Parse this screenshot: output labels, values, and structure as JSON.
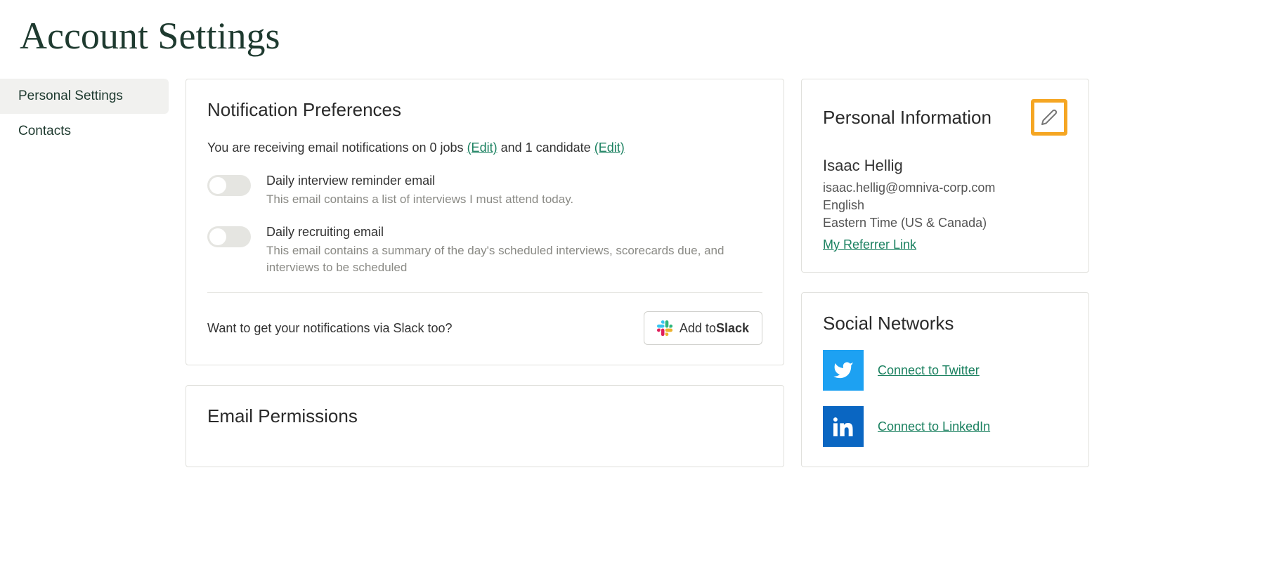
{
  "page_title": "Account Settings",
  "sidebar": {
    "items": [
      {
        "label": "Personal Settings",
        "active": true
      },
      {
        "label": "Contacts",
        "active": false
      }
    ]
  },
  "notifications": {
    "heading": "Notification Preferences",
    "line_part1": "You are receiving email notifications on 0 jobs ",
    "edit1": "(Edit)",
    "line_part2": " and 1 candidate ",
    "edit2": "(Edit)",
    "prefs": [
      {
        "title": "Daily interview reminder email",
        "desc": "This email contains a list of interviews I must attend today."
      },
      {
        "title": "Daily recruiting email",
        "desc": "This email contains a summary of the day's scheduled interviews, scorecards due, and interviews to be scheduled"
      }
    ],
    "slack_prompt": "Want to get your notifications via Slack too?",
    "slack_btn_prefix": "Add to ",
    "slack_btn_bold": "Slack"
  },
  "email_permissions": {
    "heading": "Email Permissions"
  },
  "personal_info": {
    "heading": "Personal Information",
    "name": "Isaac Hellig",
    "email": "isaac.hellig@omniva-corp.com",
    "language": "English",
    "timezone": "Eastern Time (US & Canada)",
    "referrer_link": "My Referrer Link"
  },
  "social": {
    "heading": "Social Networks",
    "twitter": "Connect to Twitter",
    "linkedin": "Connect to LinkedIn"
  }
}
